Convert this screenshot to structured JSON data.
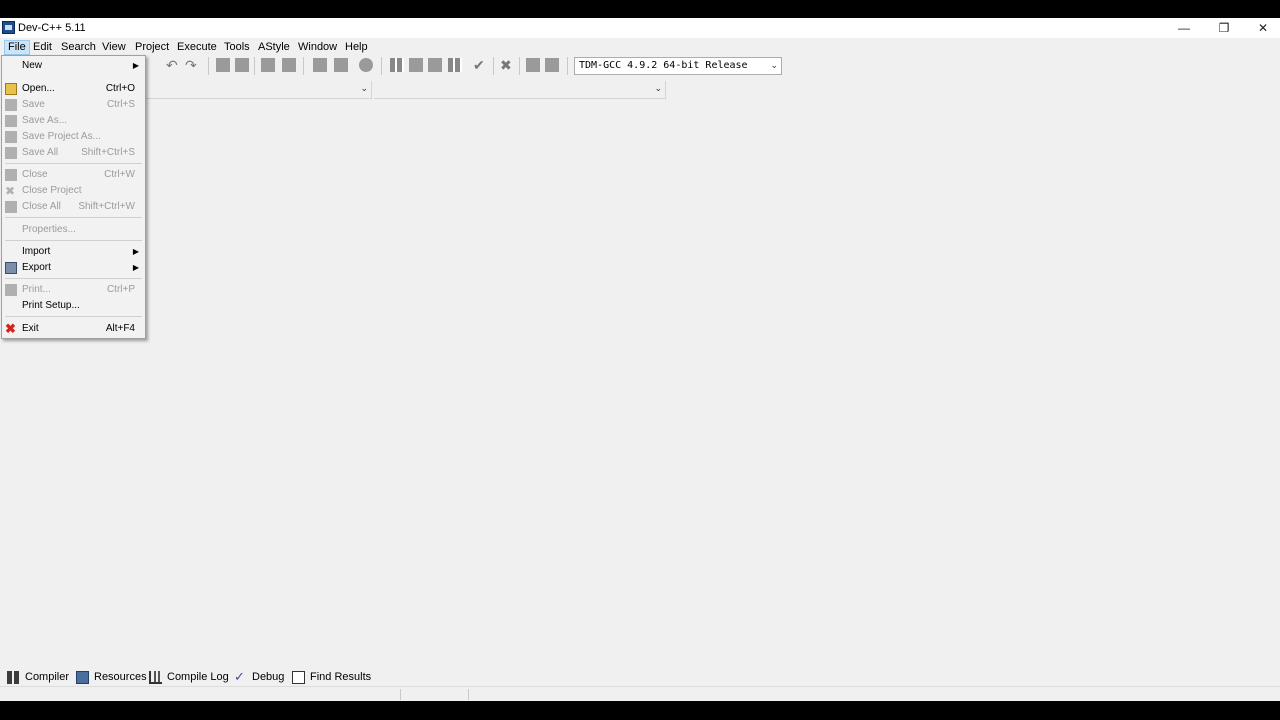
{
  "window": {
    "title": "Dev-C++ 5.11"
  },
  "menubar": [
    "File",
    "Edit",
    "Search",
    "View",
    "Project",
    "Execute",
    "Tools",
    "AStyle",
    "Window",
    "Help"
  ],
  "toolbar": {
    "compiler_select": "TDM-GCC 4.9.2 64-bit Release"
  },
  "file_menu": {
    "items": [
      {
        "label": "New",
        "shortcut": "",
        "disabled": false,
        "submenu": true,
        "icon": ""
      },
      {
        "label": "Open...",
        "shortcut": "Ctrl+O",
        "disabled": false,
        "submenu": false,
        "icon": "open-folder-icon"
      },
      {
        "label": "Save",
        "shortcut": "Ctrl+S",
        "disabled": true,
        "submenu": false,
        "icon": "save-icon"
      },
      {
        "label": "Save As...",
        "shortcut": "",
        "disabled": true,
        "submenu": false,
        "icon": "save-as-icon"
      },
      {
        "label": "Save Project As...",
        "shortcut": "",
        "disabled": true,
        "submenu": false,
        "icon": "save-project-icon"
      },
      {
        "label": "Save All",
        "shortcut": "Shift+Ctrl+S",
        "disabled": true,
        "submenu": false,
        "icon": "save-all-icon"
      },
      {
        "label": "Close",
        "shortcut": "Ctrl+W",
        "disabled": true,
        "submenu": false,
        "icon": "close-file-icon"
      },
      {
        "label": "Close Project",
        "shortcut": "",
        "disabled": true,
        "submenu": false,
        "icon": "close-project-icon"
      },
      {
        "label": "Close All",
        "shortcut": "Shift+Ctrl+W",
        "disabled": true,
        "submenu": false,
        "icon": "close-all-icon"
      },
      {
        "label": "Properties...",
        "shortcut": "",
        "disabled": true,
        "submenu": false,
        "icon": ""
      },
      {
        "label": "Import",
        "shortcut": "",
        "disabled": false,
        "submenu": true,
        "icon": ""
      },
      {
        "label": "Export",
        "shortcut": "",
        "disabled": false,
        "submenu": true,
        "icon": "export-icon"
      },
      {
        "label": "Print...",
        "shortcut": "Ctrl+P",
        "disabled": true,
        "submenu": false,
        "icon": "print-icon"
      },
      {
        "label": "Print Setup...",
        "shortcut": "",
        "disabled": false,
        "submenu": false,
        "icon": ""
      },
      {
        "label": "Exit",
        "shortcut": "Alt+F4",
        "disabled": false,
        "submenu": false,
        "icon": "exit-icon"
      }
    ]
  },
  "bottom_tabs": [
    {
      "label": "Compiler",
      "icon": "compiler-grid-icon"
    },
    {
      "label": "Resources",
      "icon": "resources-icon"
    },
    {
      "label": "Compile Log",
      "icon": "chart-icon"
    },
    {
      "label": "Debug",
      "icon": "check-icon"
    },
    {
      "label": "Find Results",
      "icon": "find-icon"
    }
  ],
  "colors": {
    "exit_icon": "#d2231e",
    "menu_highlight": "#cce4f7"
  }
}
